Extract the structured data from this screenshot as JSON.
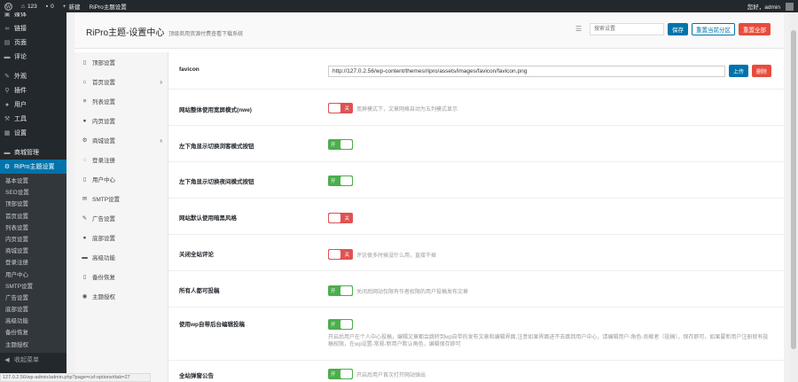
{
  "adminbar": {
    "site_count": "123",
    "comments": "0",
    "new_label": "新建",
    "theme_settings": "RiPro主题设置",
    "greeting": "您好，admin"
  },
  "wpmenu": {
    "items_top": [
      {
        "label": "媒体",
        "icon": "media-icon"
      },
      {
        "label": "链接",
        "icon": "link-icon"
      },
      {
        "label": "页面",
        "icon": "page-icon"
      },
      {
        "label": "评论",
        "icon": "comment-icon"
      }
    ],
    "items_mid": [
      {
        "label": "外观",
        "icon": "brush-icon"
      },
      {
        "label": "插件",
        "icon": "plugin-icon"
      },
      {
        "label": "用户",
        "icon": "user-icon"
      },
      {
        "label": "工具",
        "icon": "wrench-icon"
      },
      {
        "label": "设置",
        "icon": "settings-icon"
      }
    ],
    "shop": {
      "label": "商城管理",
      "icon": "shop-icon"
    },
    "active": {
      "label": "RiPro主题设置",
      "icon": "gear-icon"
    },
    "sub_items": [
      "基本设置",
      "SEO设置",
      "顶部设置",
      "首页设置",
      "列表设置",
      "内页设置",
      "商城设置",
      "登录注册",
      "用户中心",
      "SMTP设置",
      "广告设置",
      "底部设置",
      "高级功能",
      "备份恢复",
      "主题授权"
    ],
    "collapse_label": "收起菜单"
  },
  "panel": {
    "title": "RiPro主题-设置中心",
    "subtitle": "顶级商用资源付费查看下载系统",
    "search_placeholder": "搜索设置",
    "save_label": "保存",
    "reset_section_label": "重置当前分区",
    "reset_all_label": "重置全部"
  },
  "nav": [
    {
      "label": "顶部设置",
      "icon": "doc-icon",
      "chevron": false
    },
    {
      "label": "首页设置",
      "icon": "home-icon",
      "chevron": true
    },
    {
      "label": "列表设置",
      "icon": "list-icon",
      "chevron": false
    },
    {
      "label": "内页设置",
      "icon": "circle-icon",
      "chevron": false
    },
    {
      "label": "商城设置",
      "icon": "gear-icon",
      "chevron": true
    },
    {
      "label": "登录注册",
      "icon": "user-icon",
      "chevron": false
    },
    {
      "label": "用户中心",
      "icon": "doc-icon",
      "chevron": false
    },
    {
      "label": "SMTP设置",
      "icon": "mail-icon",
      "chevron": false
    },
    {
      "label": "广告设置",
      "icon": "pen-icon",
      "chevron": false
    },
    {
      "label": "底部设置",
      "icon": "circle-icon",
      "chevron": false
    },
    {
      "label": "高级功能",
      "icon": "doc-icon",
      "chevron": false
    },
    {
      "label": "备份恢复",
      "icon": "doc-icon",
      "chevron": false
    },
    {
      "label": "主题授权",
      "icon": "eye-icon",
      "chevron": false
    }
  ],
  "fields": {
    "favicon": {
      "label": "favicon",
      "value": "http://127.0.2.56/wp-content/themes/ripro/assets/images/favicon/favicon.png",
      "upload": "上传",
      "delete": "删除"
    },
    "wide": {
      "label": "网站整体使用宽屏模式(nwe)",
      "state": "关",
      "hint": "宽屏模式下，文章网格自动为五列模式显示"
    },
    "guest_btn": {
      "label": "左下角显示切换浏客模式按钮",
      "state": "开"
    },
    "night_btn": {
      "label": "左下角显示切换夜间模式按钮",
      "state": "开"
    },
    "dark": {
      "label": "网站默认使用暗黑风格",
      "state": "关"
    },
    "comments": {
      "label": "关闭全站评论",
      "state": "关",
      "hint": "评论很多时候没什么用，直接干掉"
    },
    "submit": {
      "label": "所有人都可投稿",
      "state": "开",
      "hint": "关闭后网站仅限有作者权限的用户投稿发布文章"
    },
    "editor": {
      "label": "使用wp自带后台编辑投稿",
      "state": "开",
      "desc": "开启后用户在个人中心投稿，编辑文章都会跳转到wp自带的发布文章和编辑界面,注意如果界面进不去跳回用户中心，请编辑用户-角色-贡献者（投稿），保存即可，如果要新用户注册就有投稿权限，在wp设置-常规-新用户默认角色，编辑保存即可"
    },
    "notice": {
      "label": "全站弹窗公告",
      "state": "开",
      "hint": "开启后用户首次打开网站弹出"
    }
  },
  "status_url": "127.0.2.56/wp-admin/admin.php?page=csf-options#tab=27"
}
